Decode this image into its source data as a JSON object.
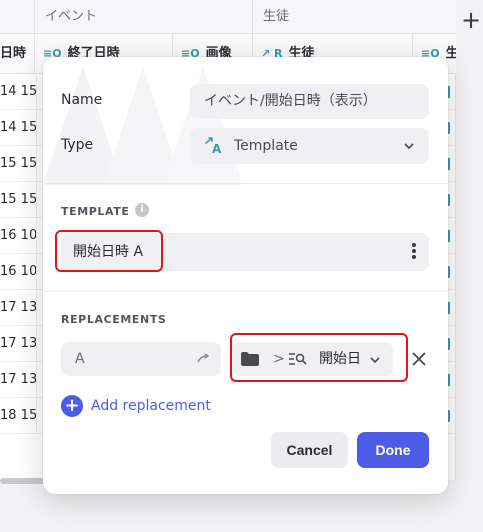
{
  "grid": {
    "group_headers": [
      "イベント",
      "生徒"
    ],
    "columns": [
      {
        "label": "日時",
        "icon": ""
      },
      {
        "label": "終了日時",
        "icon": "lookup-icon"
      },
      {
        "label": "画像",
        "icon": "lookup-icon"
      },
      {
        "label": "生徒",
        "icon": "relation-icon"
      },
      {
        "label": "生",
        "icon": "lookup-icon"
      }
    ],
    "rows": [
      "14 15",
      "14 15",
      "15 15",
      "15 15",
      "16 10",
      "16 10",
      "17 13",
      "17 13",
      "17 13",
      "18 15"
    ]
  },
  "modal": {
    "name_label": "Name",
    "name_value": "イベント/開始日時（表示）",
    "type_label": "Type",
    "type_value": "Template",
    "template_section": "TEMPLATE",
    "template_text": "開始日時 A",
    "replacements_section": "REPLACEMENTS",
    "replacement_key": "A",
    "replacement_separator": ">",
    "replacement_value": "開始日",
    "add_replacement": "Add replacement",
    "cancel_label": "Cancel",
    "done_label": "Done"
  },
  "colors": {
    "accent": "#4c5ce6",
    "highlight": "#e0141e",
    "column_icon": "#3a9ca8"
  }
}
